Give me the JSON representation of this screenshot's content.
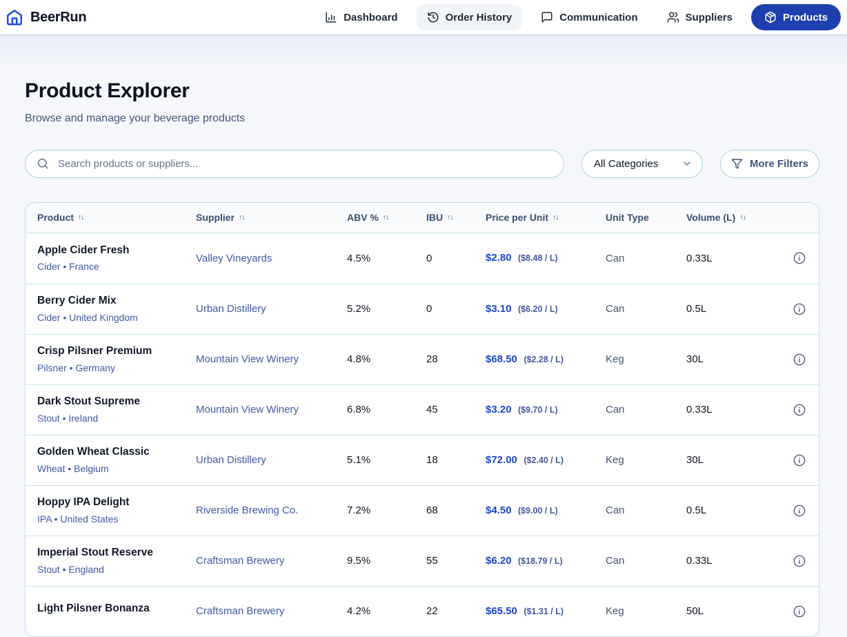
{
  "brand": {
    "name": "BeerRun"
  },
  "nav": {
    "items": [
      {
        "label": "Dashboard"
      },
      {
        "label": "Order History"
      },
      {
        "label": "Communication"
      },
      {
        "label": "Suppliers"
      },
      {
        "label": "Products"
      }
    ]
  },
  "page": {
    "title": "Product Explorer",
    "subtitle": "Browse and manage your beverage products"
  },
  "filters": {
    "search_placeholder": "Search products or suppliers...",
    "category_selected": "All Categories",
    "more_filters_label": "More Filters"
  },
  "table": {
    "sort_glyph": "↑↓",
    "headers": [
      {
        "label": "Product"
      },
      {
        "label": "Supplier"
      },
      {
        "label": "ABV %"
      },
      {
        "label": "IBU"
      },
      {
        "label": "Price per Unit"
      },
      {
        "label": "Unit Type"
      },
      {
        "label": "Volume (L)"
      }
    ],
    "rows": [
      {
        "name": "Apple Cider Fresh",
        "meta": "Cider • France",
        "supplier": "Valley Vineyards",
        "abv": "4.5%",
        "ibu": "0",
        "price": "$2.80",
        "price_per_l": "($8.48 / L)",
        "unit": "Can",
        "volume": "0.33L"
      },
      {
        "name": "Berry Cider Mix",
        "meta": "Cider • United Kingdom",
        "supplier": "Urban Distillery",
        "abv": "5.2%",
        "ibu": "0",
        "price": "$3.10",
        "price_per_l": "($6.20 / L)",
        "unit": "Can",
        "volume": "0.5L"
      },
      {
        "name": "Crisp Pilsner Premium",
        "meta": "Pilsner • Germany",
        "supplier": "Mountain View Winery",
        "abv": "4.8%",
        "ibu": "28",
        "price": "$68.50",
        "price_per_l": "($2.28 / L)",
        "unit": "Keg",
        "volume": "30L"
      },
      {
        "name": "Dark Stout Supreme",
        "meta": "Stout • Ireland",
        "supplier": "Mountain View Winery",
        "abv": "6.8%",
        "ibu": "45",
        "price": "$3.20",
        "price_per_l": "($9.70 / L)",
        "unit": "Can",
        "volume": "0.33L"
      },
      {
        "name": "Golden Wheat Classic",
        "meta": "Wheat • Belgium",
        "supplier": "Urban Distillery",
        "abv": "5.1%",
        "ibu": "18",
        "price": "$72.00",
        "price_per_l": "($2.40 / L)",
        "unit": "Keg",
        "volume": "30L"
      },
      {
        "name": "Hoppy IPA Delight",
        "meta": "IPA • United States",
        "supplier": "Riverside Brewing Co.",
        "abv": "7.2%",
        "ibu": "68",
        "price": "$4.50",
        "price_per_l": "($9.00 / L)",
        "unit": "Can",
        "volume": "0.5L"
      },
      {
        "name": "Imperial Stout Reserve",
        "meta": "Stout • England",
        "supplier": "Craftsman Brewery",
        "abv": "9.5%",
        "ibu": "55",
        "price": "$6.20",
        "price_per_l": "($18.79 / L)",
        "unit": "Can",
        "volume": "0.33L"
      },
      {
        "name": "Light Pilsner Bonanza",
        "meta": "",
        "supplier": "Craftsman Brewery",
        "abv": "4.2%",
        "ibu": "22",
        "price": "$65.50",
        "price_per_l": "($1.31 / L)",
        "unit": "Keg",
        "volume": "50L"
      }
    ]
  },
  "theme": {
    "accent_blue": "#1e40af",
    "logo_blue": "#1d4ed8",
    "link_blue": "#3f58a3",
    "price_blue": "#1c46cf",
    "divider_cyan": "#c9e5e9",
    "header_bg": "#f8fafc",
    "page_bg": "#f5f7fa"
  }
}
